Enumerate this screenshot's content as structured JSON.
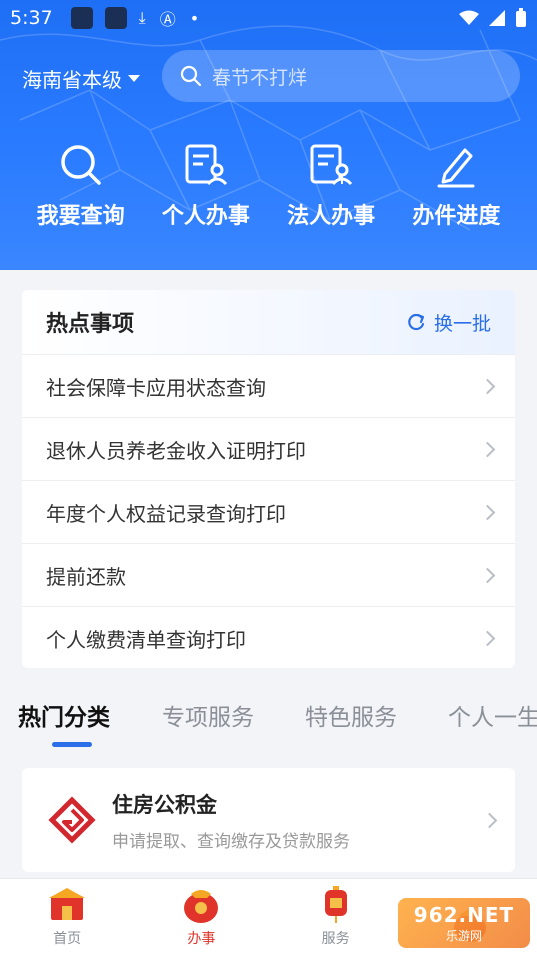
{
  "status_bar": {
    "time": "5:37"
  },
  "header": {
    "location": "海南省本级",
    "search_placeholder": "春节不打烊",
    "quick_actions": [
      {
        "label": "我要查询",
        "icon": "search-icon"
      },
      {
        "label": "个人办事",
        "icon": "personal-form-icon"
      },
      {
        "label": "法人办事",
        "icon": "legal-person-form-icon"
      },
      {
        "label": "办件进度",
        "icon": "pen-edit-icon"
      }
    ]
  },
  "hot_items": {
    "title": "热点事项",
    "refresh_label": "换一批",
    "items": [
      {
        "label": "社会保障卡应用状态查询"
      },
      {
        "label": "退休人员养老金收入证明打印"
      },
      {
        "label": "年度个人权益记录查询打印"
      },
      {
        "label": "提前还款"
      },
      {
        "label": "个人缴费清单查询打印"
      }
    ]
  },
  "tabs": [
    {
      "label": "热门分类",
      "active": true
    },
    {
      "label": "专项服务",
      "active": false
    },
    {
      "label": "特色服务",
      "active": false
    },
    {
      "label": "个人一生",
      "active": false
    }
  ],
  "service_card": {
    "title": "住房公积金",
    "subtitle": "申请提取、查询缴存及贷款服务"
  },
  "bottom_nav": [
    {
      "label": "首页",
      "active": false
    },
    {
      "label": "办事",
      "active": true
    },
    {
      "label": "服务",
      "active": false
    },
    {
      "label": "",
      "active": false
    }
  ],
  "watermark": {
    "top": "962.NET",
    "bottom": "乐游网"
  },
  "colors": {
    "primary": "#2b6fe8",
    "header_blue": "#2a7bff",
    "active_nav": "#e0342a"
  }
}
